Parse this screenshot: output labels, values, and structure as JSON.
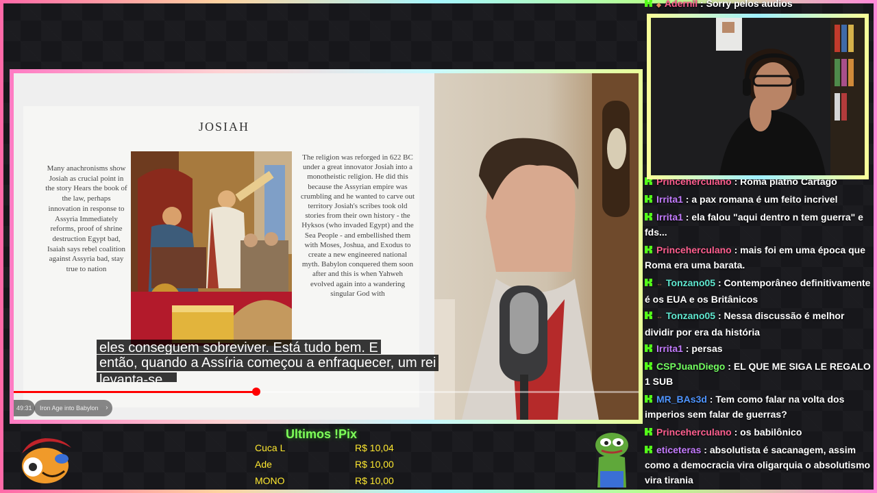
{
  "video": {
    "slide": {
      "title": "JOSIAH",
      "left_text": "Many anachronisms show Josiah as crucial point in the story Hears the book of the law, perhaps innovation in response to Assyria Immediately reforms, proof of shrine destruction Egypt bad, Isaiah says rebel coalition against Assyria bad, stay true to nation",
      "right_text": "The religion was reforged in 622 BC under a great innovator Josiah into a monotheistic religion. He did this because the Assyrian empire was crumbling and he wanted to carve out territory Josiah's scribes took old stories from their own history - the Hyksos (who invaded Egypt) and the Sea People - and embellished them with Moses, Joshua, and Exodus to create a new engineered national myth. Babylon conquered them soon after and this is when Yahweh evolved again into a wandering singular God with"
    },
    "subtitle": {
      "line_top": "eles conseguem sobreviver. Está tudo bem. E",
      "line_middle": "então, quando a Assíria começou a enfraquecer, um rei",
      "line_bottom": "levanta-se..."
    },
    "progress": {
      "played_fraction": 0.388
    },
    "time": "49:31",
    "chapter": "Iron Age into Babylon",
    "chapter_chevron": "›"
  },
  "chat": {
    "messages": [
      {
        "user": "Adernil",
        "text": "Sorry pelos audios",
        "user_color": "pink",
        "badges": [
          "kick",
          "cube"
        ]
      },
      {
        "user": "Princeherculano",
        "text": "Roma platno Cartago",
        "user_color": "pink",
        "badges": [
          "kick"
        ]
      },
      {
        "user": "Irrita1",
        "text": "a pax romana é um feito incrivel",
        "user_color": "violet",
        "badges": [
          "kick"
        ]
      },
      {
        "user": "Irrita1",
        "text": "ela falou \"aqui dentro n tem guerra\" e fds...",
        "user_color": "violet",
        "badges": [
          "kick"
        ]
      },
      {
        "user": "Princeherculano",
        "text": "mais foi em uma época que Roma era uma barata.",
        "user_color": "pink",
        "badges": [
          "kick"
        ]
      },
      {
        "user": "Tonzano05",
        "text": "Contemporâneo definitivamente é os EUA e os Britânicos",
        "user_color": "teal",
        "badges": [
          "kick",
          "sub"
        ]
      },
      {
        "user": "Tonzano05",
        "text": "Nessa discussão é melhor dividir por era da história",
        "user_color": "teal",
        "badges": [
          "kick",
          "sub"
        ]
      },
      {
        "user": "Irrita1",
        "text": "persas",
        "user_color": "violet",
        "badges": [
          "kick"
        ]
      },
      {
        "user": "CSPJuanDiego",
        "text": "EL QUE ME SIGA LE REGALO 1 SUB",
        "user_color": "lime",
        "badges": [
          "kick"
        ]
      },
      {
        "user": "MR_BAs3d",
        "text": "Tem como falar na volta dos imperios sem falar de guerras?",
        "user_color": "blue",
        "badges": [
          "kick"
        ]
      },
      {
        "user": "Princeherculano",
        "text": "os babilônico",
        "user_color": "pink",
        "badges": [
          "kick"
        ]
      },
      {
        "user": "eticeteras",
        "text": "absolutista é sacanagem, assim como a democracia vira oligarquia o absolutismo vira tirania",
        "user_color": "violet",
        "badges": [
          "kick"
        ]
      }
    ],
    "separator": " : "
  },
  "pix": {
    "title": "Ultimos !Pix",
    "entries": [
      {
        "name": "Cuca L",
        "value": "R$ 10,04"
      },
      {
        "name": "Ade",
        "value": "R$ 10,00"
      },
      {
        "name": "MONO",
        "value": "R$ 10,00"
      }
    ]
  },
  "colors": {
    "kick_green": "#53fc18",
    "progress_red": "#ff0000",
    "pix_yellow": "#ffe930",
    "pix_title_green": "#7fff5a"
  },
  "icons": [
    "kick-badge-icon",
    "subscriber-badge-icon",
    "chevron-right-icon",
    "mascot-character-icon",
    "pepe-frog-icon"
  ]
}
